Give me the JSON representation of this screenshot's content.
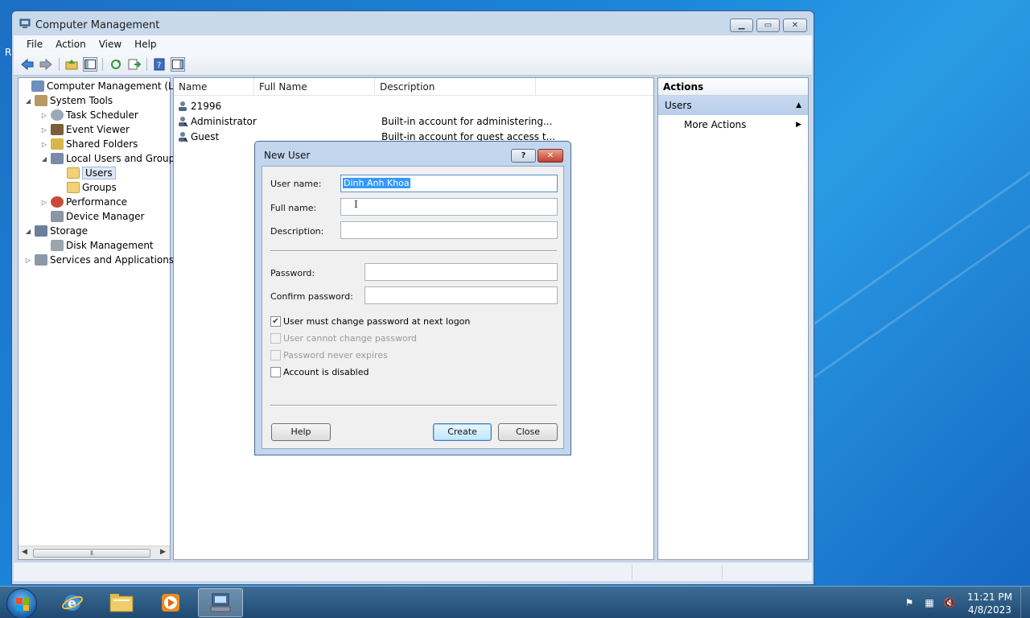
{
  "window": {
    "title": "Computer Management",
    "menu": [
      "File",
      "Action",
      "View",
      "Help"
    ]
  },
  "tree": {
    "items": [
      {
        "label": "Computer Management (Local",
        "icon": "computer-management-icon",
        "expander": ""
      },
      {
        "label": "System Tools",
        "icon": "tools-icon",
        "expander": "◢"
      },
      {
        "label": "Task Scheduler",
        "icon": "clock-icon",
        "expander": "▷"
      },
      {
        "label": "Event Viewer",
        "icon": "event-viewer-icon",
        "expander": "▷"
      },
      {
        "label": "Shared Folders",
        "icon": "shared-folder-icon",
        "expander": "▷"
      },
      {
        "label": "Local Users and Groups",
        "icon": "users-groups-icon",
        "expander": "◢"
      },
      {
        "label": "Users",
        "icon": "folder-icon",
        "expander": ""
      },
      {
        "label": "Groups",
        "icon": "folder-icon",
        "expander": ""
      },
      {
        "label": "Performance",
        "icon": "performance-icon",
        "expander": "▷"
      },
      {
        "label": "Device Manager",
        "icon": "device-manager-icon",
        "expander": ""
      },
      {
        "label": "Storage",
        "icon": "storage-icon",
        "expander": "◢"
      },
      {
        "label": "Disk Management",
        "icon": "disk-icon",
        "expander": ""
      },
      {
        "label": "Services and Applications",
        "icon": "services-icon",
        "expander": "▷"
      }
    ]
  },
  "list": {
    "columns": [
      "Name",
      "Full Name",
      "Description"
    ],
    "rows": [
      {
        "name": "21996",
        "full_name": "",
        "description": ""
      },
      {
        "name": "Administrator",
        "full_name": "",
        "description": "Built-in account for administering..."
      },
      {
        "name": "Guest",
        "full_name": "",
        "description": "Built-in account for guest access t..."
      }
    ]
  },
  "actions": {
    "header": "Actions",
    "section": "Users",
    "item": "More Actions"
  },
  "dialog": {
    "title": "New User",
    "help_glyph": "?",
    "close_glyph": "✕",
    "user_name_label": "User name:",
    "user_name_value": "Dinh Anh Khoa",
    "full_name_label": "Full name:",
    "full_name_value": "",
    "description_label": "Description:",
    "description_value": "",
    "password_label": "Password:",
    "confirm_label": "Confirm password:",
    "checkboxes": [
      {
        "label": "User must change password at next logon",
        "checked": true,
        "enabled": true
      },
      {
        "label": "User cannot change password",
        "checked": false,
        "enabled": false
      },
      {
        "label": "Password never expires",
        "checked": false,
        "enabled": false
      },
      {
        "label": "Account is disabled",
        "checked": false,
        "enabled": true
      }
    ],
    "help_button": "Help",
    "create_button": "Create",
    "close_button": "Close"
  },
  "taskbar": {
    "time": "11:21 PM",
    "date": "4/8/2023"
  },
  "colors": {
    "accent": "#3399ff",
    "desktop": "#1b86d9"
  }
}
